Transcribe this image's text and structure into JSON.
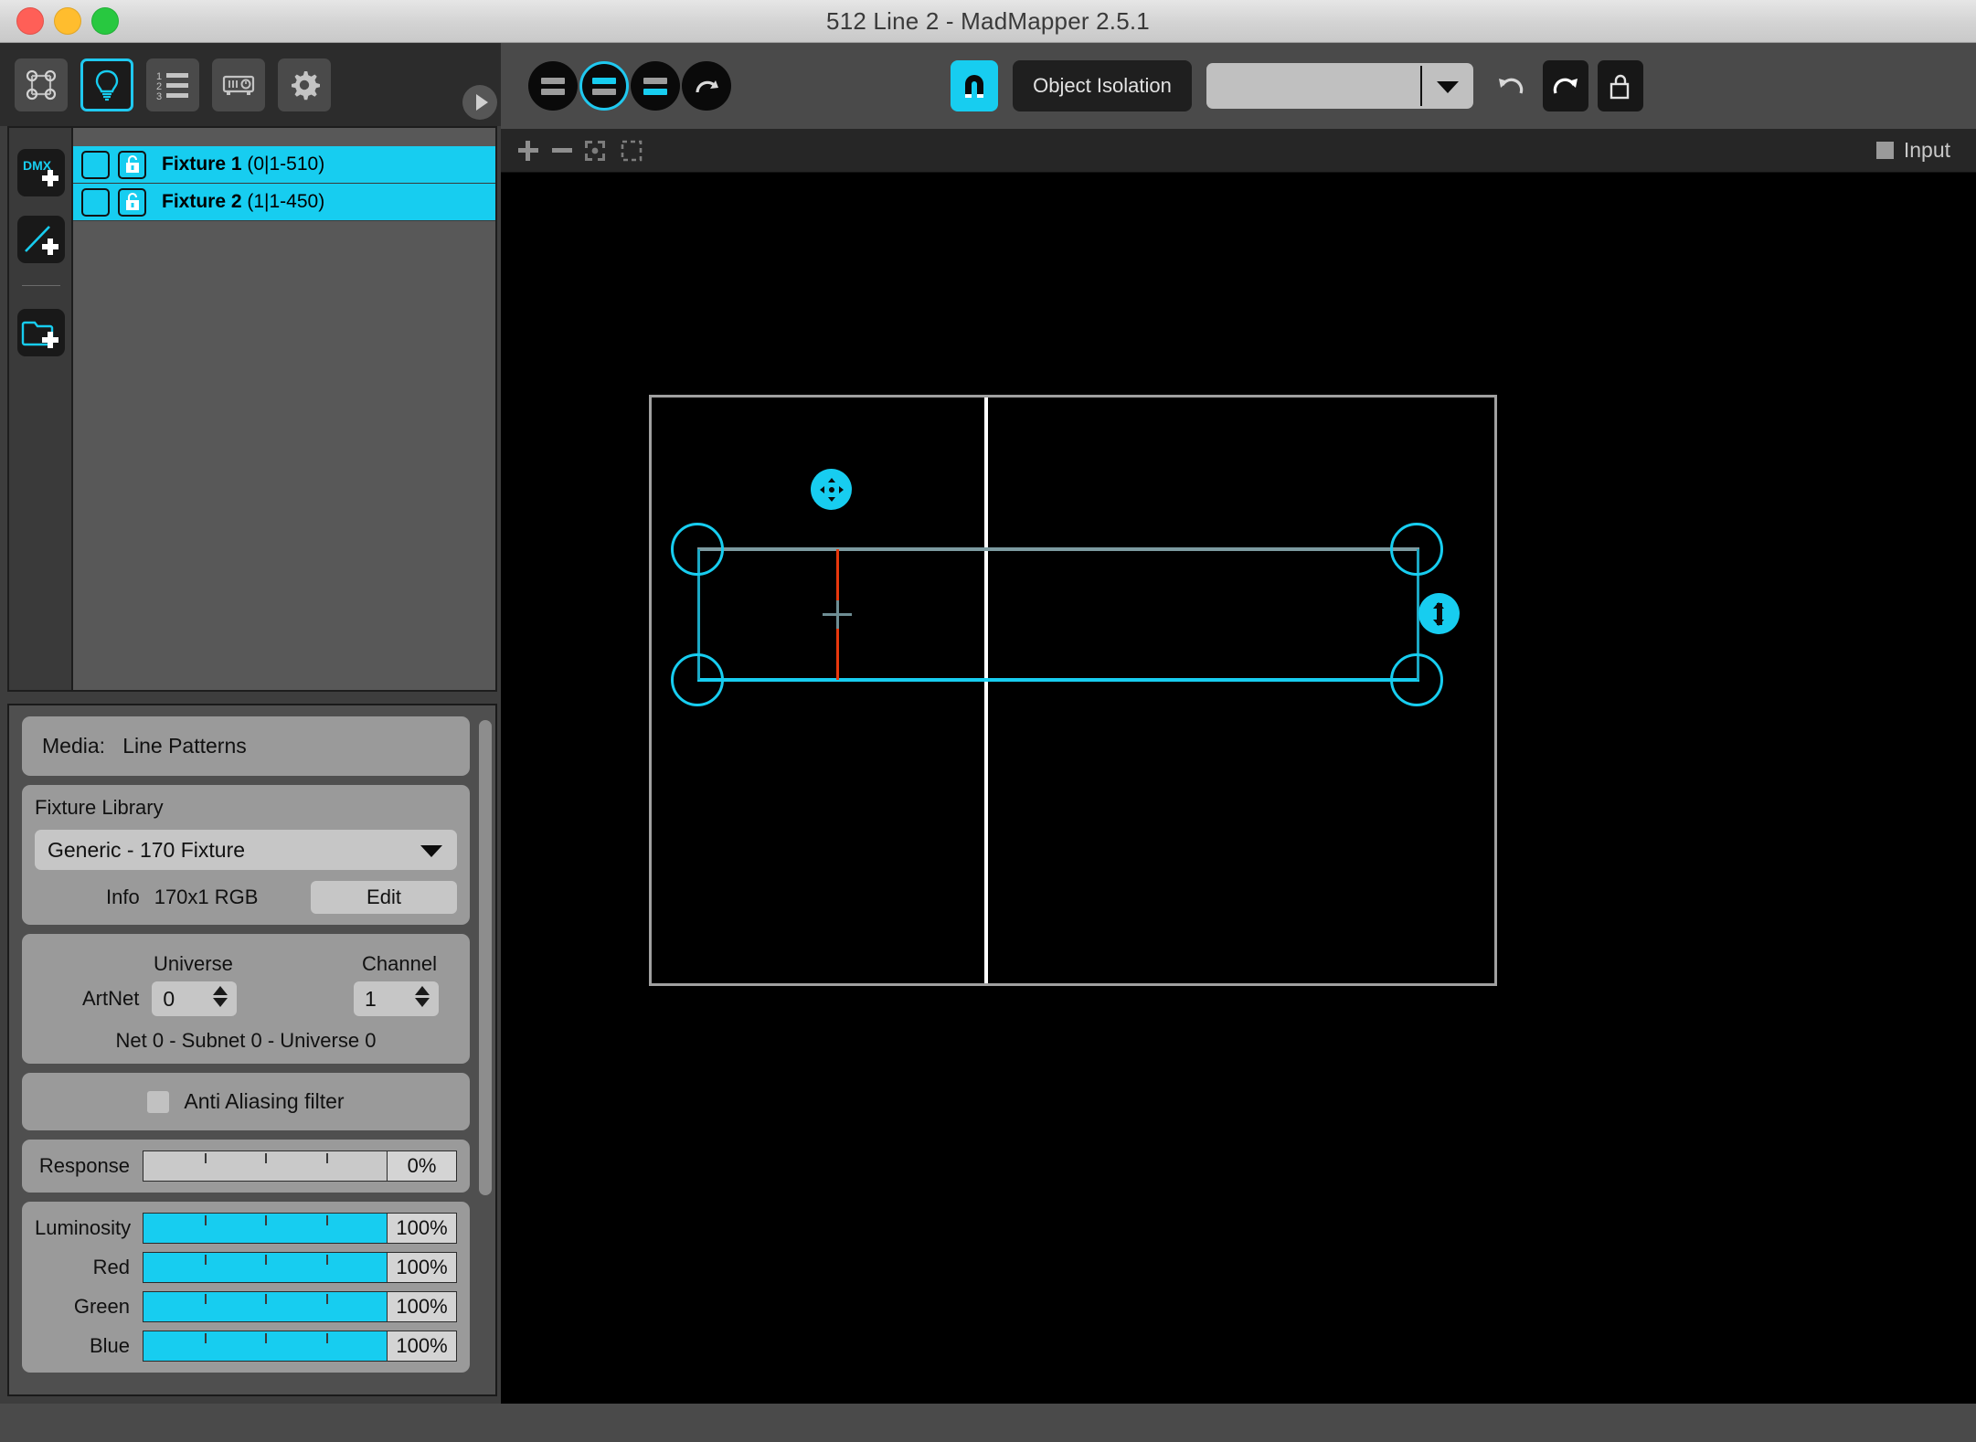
{
  "window": {
    "title": "512 Line 2 - MadMapper 2.5.1",
    "traffic_lights": [
      "close",
      "minimize",
      "maximize"
    ],
    "accent_cyan": "#17cdf0",
    "bg_dark": "#3d3d3d"
  },
  "mode_toolbar": {
    "items": [
      {
        "name": "surfaces",
        "icon": "quad-nodes-icon",
        "active": false
      },
      {
        "name": "fixtures",
        "icon": "lightbulb-icon",
        "active": true
      },
      {
        "name": "cue-list",
        "icon": "numbered-list-icon",
        "active": false
      },
      {
        "name": "outputs",
        "icon": "projector-icon",
        "active": false
      },
      {
        "name": "preferences",
        "icon": "gear-icon",
        "active": false
      }
    ],
    "disclosure": "play-triangle-icon"
  },
  "side_tools": [
    {
      "name": "add-dmx-fixture",
      "label": "DMX",
      "icon": "dmx-plus-icon"
    },
    {
      "name": "add-line-fixture",
      "icon": "line-plus-icon"
    },
    {
      "name": "add-group",
      "icon": "folder-plus-icon"
    }
  ],
  "fixtures": [
    {
      "name": "Fixture 1",
      "range": "(0|1-510)",
      "selected": true,
      "checked": true,
      "locked": false
    },
    {
      "name": "Fixture 2",
      "range": "(1|1-450)",
      "selected": true,
      "checked": true,
      "locked": false
    }
  ],
  "properties": {
    "media_label": "Media:",
    "media_value": "Line Patterns",
    "fixture_library_title": "Fixture Library",
    "fixture_library_value": "Generic - 170 Fixture",
    "info_label": "Info",
    "info_value": "170x1 RGB",
    "edit_label": "Edit",
    "universe_label": "Universe",
    "channel_label": "Channel",
    "protocol_label": "ArtNet",
    "universe_value": "0",
    "channel_value": "1",
    "net_line": "Net 0 - Subnet 0 - Universe 0",
    "anti_aliasing_label": "Anti Aliasing filter",
    "anti_aliasing_checked": false,
    "response_label": "Response",
    "response_value": "0%",
    "response_percent": 0,
    "sliders": [
      {
        "label": "Luminosity",
        "value": "100%",
        "percent": 100
      },
      {
        "label": "Red",
        "value": "100%",
        "percent": 100
      },
      {
        "label": "Green",
        "value": "100%",
        "percent": 100
      },
      {
        "label": "Blue",
        "value": "100%",
        "percent": 100
      }
    ]
  },
  "canvas_toolbar": {
    "mode_buttons": [
      {
        "name": "layer-both",
        "selected": false
      },
      {
        "name": "layer-top",
        "selected": true
      },
      {
        "name": "layer-bottom",
        "selected": false
      },
      {
        "name": "rotate-mode",
        "selected": false
      }
    ],
    "snap_icon": "magnet-icon",
    "snap_active": true,
    "object_isolation_label": "Object Isolation",
    "isolation_select_value": "",
    "undo_icon": "undo-arrow-icon",
    "redo_icon": "redo-arrow-icon",
    "lock_icon": "lock-icon"
  },
  "canvas_subbar": {
    "icons": [
      {
        "name": "zoom-in",
        "glyph": "+"
      },
      {
        "name": "zoom-out",
        "glyph": "−"
      },
      {
        "name": "fit-to-screen"
      },
      {
        "name": "selection-marquee"
      }
    ],
    "input_label": "Input"
  },
  "canvas": {
    "stage_border_color": "#a0a0a0",
    "divider_color": "#ffffff",
    "fixture_line_1_color": "#7c9aa0",
    "fixture_line_2_color": "#17cdf0",
    "center_guide_color": "#e8380d",
    "move_handle_icon": "move-arrows-icon",
    "rotate_handle_icon": "resize-vertical-icon"
  }
}
